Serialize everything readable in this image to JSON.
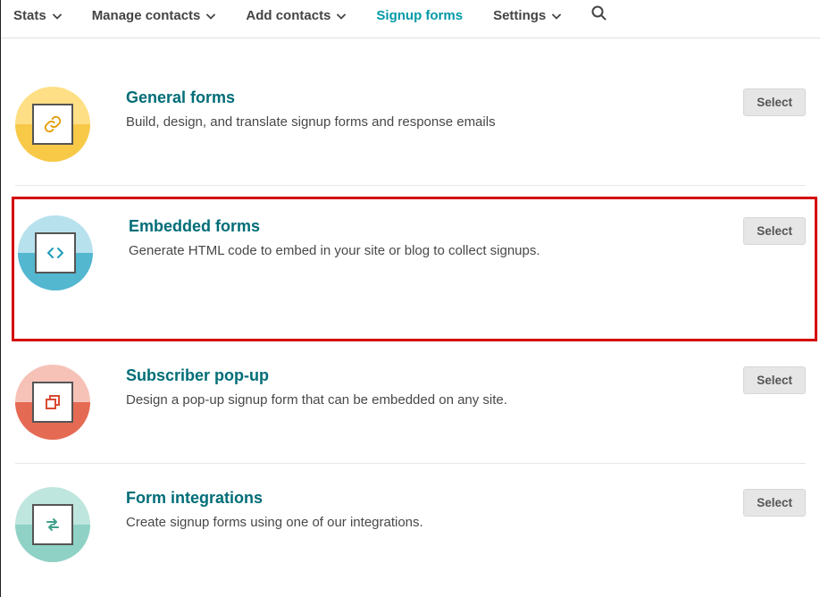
{
  "nav": {
    "stats": "Stats",
    "manage_contacts": "Manage contacts",
    "add_contacts": "Add contacts",
    "signup_forms": "Signup forms",
    "settings": "Settings"
  },
  "cards": {
    "general": {
      "title": "General forms",
      "desc": "Build, design, and translate signup forms and response emails",
      "button": "Select",
      "colors": {
        "top": "#FFDF85",
        "bottom": "#F7C947",
        "icon": "#E59A00"
      }
    },
    "embedded": {
      "title": "Embedded forms",
      "desc": "Generate HTML code to embed in your site or blog to collect signups.",
      "button": "Select",
      "colors": {
        "top": "#B8E1EE",
        "bottom": "#52B7CF",
        "icon": "#1B9CB8"
      }
    },
    "popup": {
      "title": "Subscriber pop-up",
      "desc": "Design a pop-up signup form that can be embedded on any site.",
      "button": "Select",
      "colors": {
        "top": "#F6C2B8",
        "bottom": "#E56A54",
        "icon": "#D94A32"
      }
    },
    "integrations": {
      "title": "Form integrations",
      "desc": "Create signup forms using one of our integrations.",
      "button": "Select",
      "colors": {
        "top": "#BFE6DE",
        "bottom": "#8FD1C5",
        "icon": "#3FA08C"
      }
    }
  }
}
